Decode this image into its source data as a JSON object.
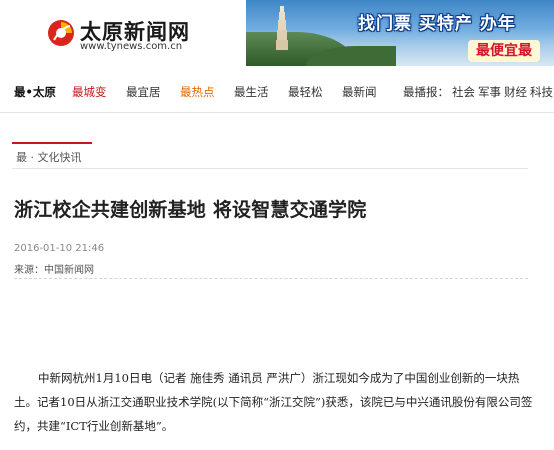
{
  "site": {
    "name": "太原新闻网",
    "url": "www.tynews.com.cn"
  },
  "banner": {
    "slogan": "找门票  买特产  办年",
    "tag": "最便宜最"
  },
  "nav": {
    "items": [
      {
        "label": "最•太原",
        "style": "active"
      },
      {
        "label": "最城变",
        "style": "red"
      },
      {
        "label": "最宜居",
        "style": "normal"
      },
      {
        "label": "最热点",
        "style": "orange"
      },
      {
        "label": "最生活",
        "style": "normal"
      },
      {
        "label": "最轻松",
        "style": "normal"
      },
      {
        "label": "最新闻",
        "style": "normal"
      }
    ],
    "broadcast_label": "最播报：",
    "broadcast_items": [
      "社会",
      "军事",
      "财经",
      "科技"
    ]
  },
  "breadcrumb": "最 · 文化快讯",
  "article": {
    "title": "浙江校企共建创新基地 将设智慧交通学院",
    "date": "2016-01-10 21:46",
    "source_label": "来源：",
    "source": "中国新闻网",
    "body": "中新网杭州1月10日电（记者 施佳秀 通讯员 严洪广）浙江现如今成为了中国创业创新的一块热土。记者10日从浙江交通职业技术学院(以下简称“浙江交院”)获悉，该院已与中兴通讯股份有限公司签约，共建“ICT行业创新基地”。"
  },
  "colors": {
    "accent_red": "#c8161d",
    "accent_orange": "#e46a00",
    "banner_blue": "#3f86c7"
  }
}
